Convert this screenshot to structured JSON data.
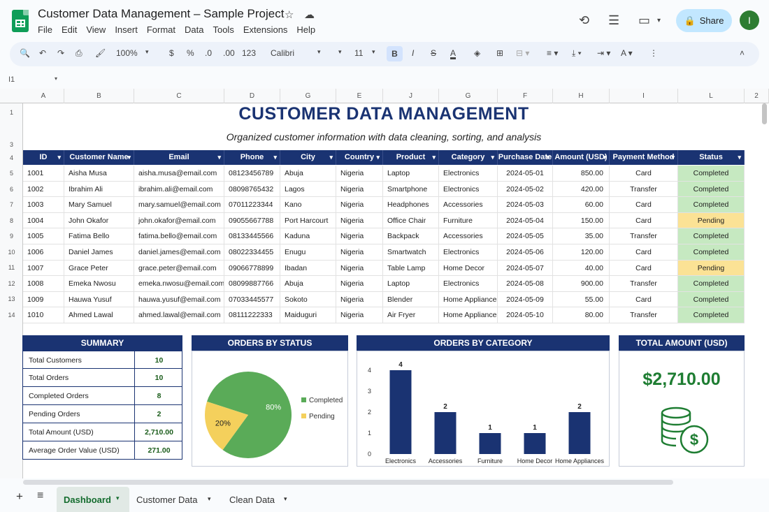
{
  "app": {
    "title": "Customer Data Management – Sample Project",
    "menu": [
      "File",
      "Edit",
      "View",
      "Insert",
      "Format",
      "Data",
      "Tools",
      "Extensions",
      "Help"
    ],
    "share_label": "Share",
    "avatar_letter": "I"
  },
  "toolbar": {
    "zoom": "100%",
    "currency": "$",
    "percent": "%",
    "dec_less": ".0",
    "dec_more": ".00",
    "number_format": "123",
    "font": "Calibri",
    "font_size": "11",
    "bold": "B",
    "italic": "I",
    "strike": "S",
    "text_color": "A"
  },
  "formula_bar": {
    "cell_ref": "I1"
  },
  "columns": [
    "A",
    "B",
    "C",
    "D",
    "G",
    "E",
    "J",
    "G",
    "F",
    "H",
    "I",
    "L",
    "2"
  ],
  "row_numbers": [
    "1",
    "3",
    "4",
    "5",
    "6",
    "7",
    "8",
    "9",
    "10",
    "11",
    "12",
    "13",
    "14"
  ],
  "sheet": {
    "title": "CUSTOMER DATA MANAGEMENT",
    "subtitle": "Organized customer information with data cleaning, sorting, and analysis",
    "headers": [
      "ID",
      "Customer Name",
      "Email",
      "Phone",
      "City",
      "Country",
      "Product",
      "Category",
      "Purchase Date",
      "Amount (USD)",
      "Payment Method",
      "Status"
    ],
    "rows": [
      [
        "1001",
        "Aisha Musa",
        "aisha.musa@email.com",
        "08123456789",
        "Abuja",
        "Nigeria",
        "Laptop",
        "Electronics",
        "2024-05-01",
        "850.00",
        "Card",
        "Completed"
      ],
      [
        "1002",
        "Ibrahim Ali",
        "ibrahim.ali@email.com",
        "08098765432",
        "Lagos",
        "Nigeria",
        "Smartphone",
        "Electronics",
        "2024-05-02",
        "420.00",
        "Transfer",
        "Completed"
      ],
      [
        "1003",
        "Mary Samuel",
        "mary.samuel@email.com",
        "07011223344",
        "Kano",
        "Nigeria",
        "Headphones",
        "Accessories",
        "2024-05-03",
        "60.00",
        "Card",
        "Completed"
      ],
      [
        "1004",
        "John Okafor",
        "john.okafor@email.com",
        "09055667788",
        "Port Harcourt",
        "Nigeria",
        "Office Chair",
        "Furniture",
        "2024-05-04",
        "150.00",
        "Card",
        "Pending"
      ],
      [
        "1005",
        "Fatima Bello",
        "fatima.bello@email.com",
        "08133445566",
        "Kaduna",
        "Nigeria",
        "Backpack",
        "Accessories",
        "2024-05-05",
        "35.00",
        "Transfer",
        "Completed"
      ],
      [
        "1006",
        "Daniel James",
        "daniel.james@email.com",
        "08022334455",
        "Enugu",
        "Nigeria",
        "Smartwatch",
        "Electronics",
        "2024-05-06",
        "120.00",
        "Card",
        "Completed"
      ],
      [
        "1007",
        "Grace Peter",
        "grace.peter@email.com",
        "09066778899",
        "Ibadan",
        "Nigeria",
        "Table Lamp",
        "Home Decor",
        "2024-05-07",
        "40.00",
        "Card",
        "Pending"
      ],
      [
        "1008",
        "Emeka Nwosu",
        "emeka.nwosu@email.com",
        "08099887766",
        "Abuja",
        "Nigeria",
        "Laptop",
        "Electronics",
        "2024-05-08",
        "900.00",
        "Transfer",
        "Completed"
      ],
      [
        "1009",
        "Hauwa Yusuf",
        "hauwa.yusuf@email.com",
        "07033445577",
        "Sokoto",
        "Nigeria",
        "Blender",
        "Home Appliances",
        "2024-05-09",
        "55.00",
        "Card",
        "Completed"
      ],
      [
        "1010",
        "Ahmed Lawal",
        "ahmed.lawal@email.com",
        "08111222333",
        "Maiduguri",
        "Nigeria",
        "Air Fryer",
        "Home Appliances",
        "2024-05-10",
        "80.00",
        "Transfer",
        "Completed"
      ]
    ]
  },
  "summary": {
    "title": "SUMMARY",
    "items": [
      {
        "label": "Total Customers",
        "value": "10"
      },
      {
        "label": "Total Orders",
        "value": "10"
      },
      {
        "label": "Completed Orders",
        "value": "8"
      },
      {
        "label": "Pending Orders",
        "value": "2"
      },
      {
        "label": "Total Amount (USD)",
        "value": "2,710.00"
      },
      {
        "label": "Average Order Value (USD)",
        "value": "271.00"
      }
    ]
  },
  "total_amount": {
    "title": "TOTAL AMOUNT (USD)",
    "value": "$2,710.00"
  },
  "chart_data": [
    {
      "type": "pie",
      "title": "ORDERS BY STATUS",
      "labels": [
        "Completed",
        "Pending"
      ],
      "values": [
        80,
        20
      ],
      "colors": [
        "#5aab58",
        "#f4d05c"
      ],
      "legend": "right"
    },
    {
      "type": "bar",
      "title": "ORDERS BY CATEGORY",
      "categories": [
        "Electronics",
        "Accessories",
        "Furniture",
        "Home Decor",
        "Home Appliances"
      ],
      "values": [
        4,
        2,
        1,
        1,
        2
      ],
      "ylim": [
        0,
        4
      ],
      "yticks": [
        "0",
        "1",
        "2",
        "3",
        "4"
      ],
      "color": "#1a3372"
    }
  ],
  "tabs": [
    "Dashboard",
    "Customer Data",
    "Clean Data"
  ]
}
